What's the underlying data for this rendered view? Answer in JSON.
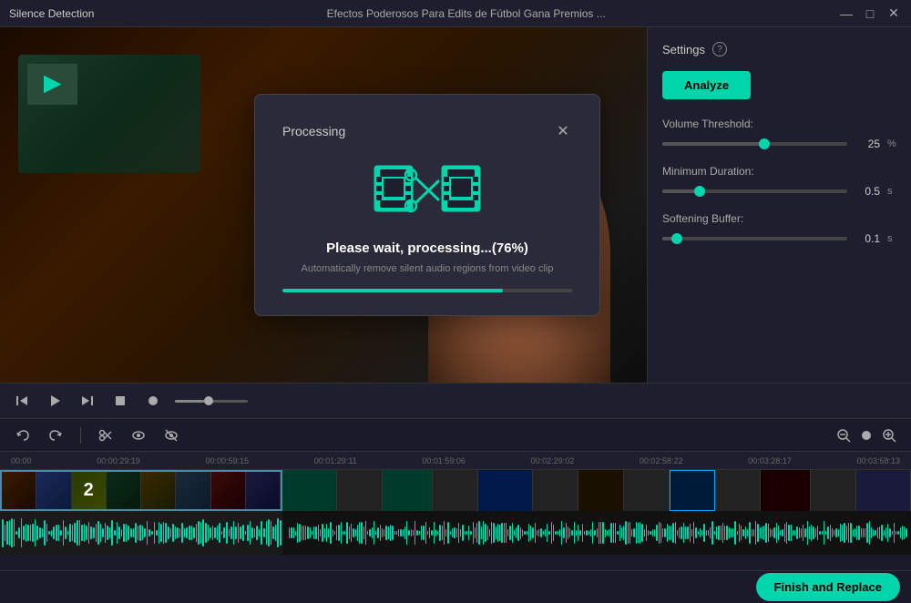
{
  "titleBar": {
    "appTitle": "Silence Detection",
    "windowTitle": "Efectos Poderosos Para Edits de Fútbol  Gana Premios ...",
    "minimizeBtn": "—",
    "maximizeBtn": "□",
    "closeBtn": "✕"
  },
  "settings": {
    "title": "Settings",
    "analyzeBtn": "Analyze",
    "volumeThreshold": {
      "label": "Volume Threshold:",
      "value": "25",
      "unit": "%",
      "percent": 55
    },
    "minimumDuration": {
      "label": "Minimum Duration:",
      "value": "0.5",
      "unit": "s",
      "percent": 20
    },
    "softeningBuffer": {
      "label": "Softening Buffer:",
      "value": "0.1",
      "unit": "s",
      "percent": 8
    }
  },
  "processingDialog": {
    "title": "Processing",
    "closeBtn": "✕",
    "progressText": "Please wait, processing...(76%)",
    "subText": "Automatically remove silent audio regions from video clip",
    "progressPercent": 76
  },
  "playbackControls": {
    "prevBtn": "⏮",
    "playBtn": "▶",
    "nextBtn": "▶▶",
    "stopBtn": "■",
    "recordBtn": "●"
  },
  "toolbar": {
    "undoBtn": "↩",
    "redoBtn": "↪",
    "cutBtn": "✂",
    "eyeBtn": "👁",
    "hideBtn": "🚫"
  },
  "timelineRuler": {
    "marks": [
      "00:00",
      "00:00:29:19",
      "00:00:59:15",
      "00:01:29:11",
      "00:01:59:06",
      "00:02:29:02",
      "00:02:58:22",
      "00:03:28:17",
      "00:03:58:13"
    ]
  },
  "bottomBar": {
    "finishBtn": "Finish and Replace"
  }
}
